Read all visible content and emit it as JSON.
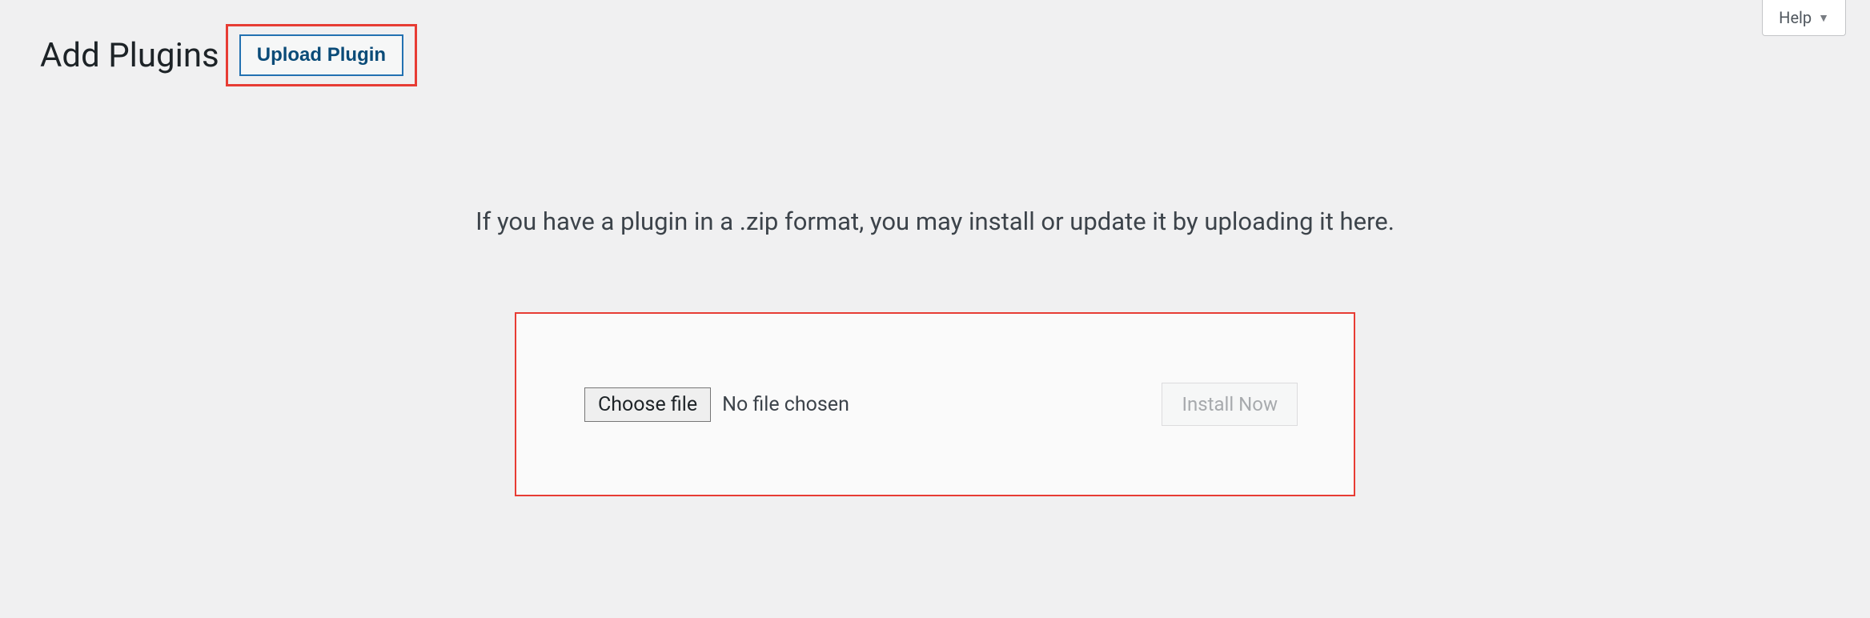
{
  "help": {
    "label": "Help"
  },
  "header": {
    "title": "Add Plugins",
    "uploadButton": "Upload Plugin"
  },
  "instruction": "If you have a plugin in a .zip format, you may install or update it by uploading it here.",
  "uploadPanel": {
    "chooseFileLabel": "Choose file",
    "fileStatus": "No file chosen",
    "installNowLabel": "Install Now"
  }
}
